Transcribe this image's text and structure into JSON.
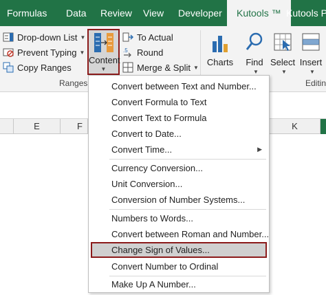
{
  "colors": {
    "accent": "#217346",
    "highlight_border": "#8b1a1a"
  },
  "tabs": [
    {
      "label": "Formulas",
      "active": false
    },
    {
      "label": "Data",
      "active": false
    },
    {
      "label": "Review",
      "active": false
    },
    {
      "label": "View",
      "active": false
    },
    {
      "label": "Developer",
      "active": false
    },
    {
      "label": "Kutools ™",
      "active": true
    },
    {
      "label": "Kutools Plu",
      "active": false
    }
  ],
  "ribbon": {
    "ranges_group": {
      "dropdown_list": "Drop-down List",
      "prevent_typing": "Prevent Typing",
      "copy_ranges": "Copy Ranges",
      "group_label": "Ranges &"
    },
    "content_button": {
      "label": "Content",
      "icon": "content-icon"
    },
    "convert_group": {
      "to_actual": "To Actual",
      "round": "Round",
      "merge_split": "Merge & Split"
    },
    "charts": "Charts",
    "find": "Find",
    "select": "Select",
    "insert": "Insert",
    "editing_label": "Editin"
  },
  "columns": [
    "E",
    "F",
    "K"
  ],
  "menu": {
    "items": [
      {
        "label": "Convert between Text and Number...",
        "submenu": false,
        "highlight": false
      },
      {
        "label": "Convert Formula to Text",
        "submenu": false,
        "highlight": false
      },
      {
        "label": "Convert Text to Formula",
        "submenu": false,
        "highlight": false
      },
      {
        "label": "Convert to Date...",
        "submenu": false,
        "highlight": false
      },
      {
        "label": "Convert Time...",
        "submenu": true,
        "highlight": false
      },
      {
        "label": "Currency Conversion...",
        "submenu": false,
        "highlight": false
      },
      {
        "label": "Unit Conversion...",
        "submenu": false,
        "highlight": false
      },
      {
        "label": "Conversion of Number Systems...",
        "submenu": false,
        "highlight": false
      },
      {
        "label": "Numbers to Words...",
        "submenu": false,
        "highlight": false
      },
      {
        "label": "Convert between Roman and Number...",
        "submenu": false,
        "highlight": false
      },
      {
        "label": "Change Sign of Values...",
        "submenu": false,
        "highlight": true
      },
      {
        "label": "Convert Number to Ordinal",
        "submenu": false,
        "highlight": false
      },
      {
        "label": "Make Up A Number...",
        "submenu": false,
        "highlight": false
      }
    ]
  }
}
